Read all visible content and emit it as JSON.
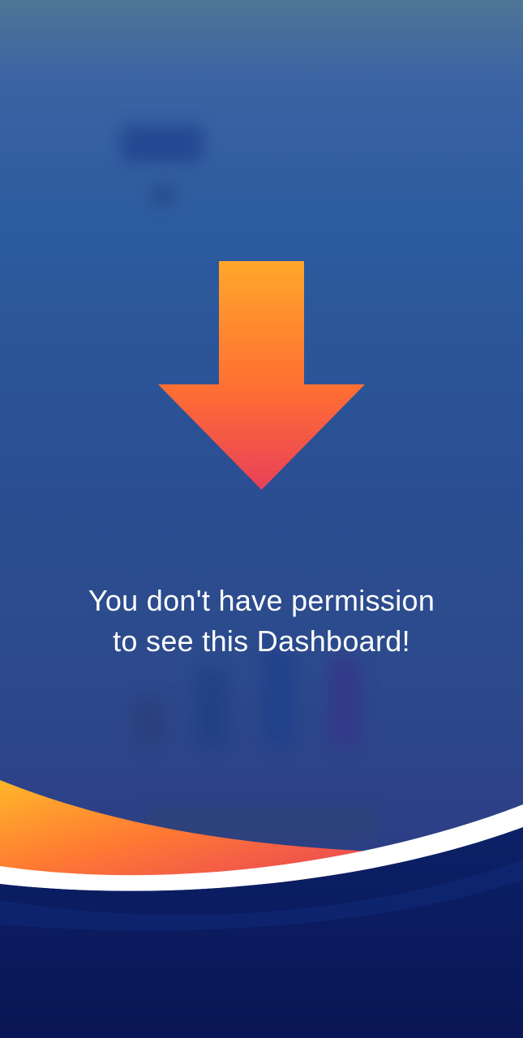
{
  "message": {
    "line1": "You don't have permission",
    "line2": "to see this Dashboard!"
  },
  "icons": {
    "arrow": "arrow-down-icon"
  },
  "colors": {
    "background_top": "#4f7596",
    "background_mid": "#2b4f93",
    "arrow_top": "#ffa72a",
    "arrow_bottom": "#e8405a",
    "footer_navy": "#0b1757",
    "accent_wave_orange": "#ff7b32",
    "accent_wave_white": "#ffffff"
  }
}
